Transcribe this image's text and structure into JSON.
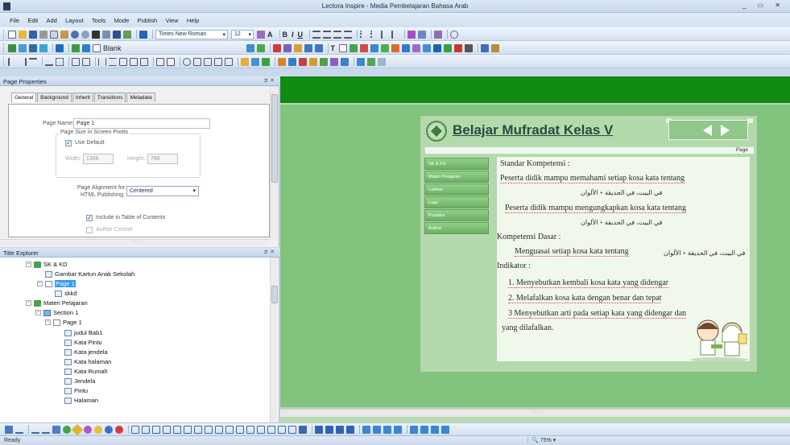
{
  "window": {
    "title": "Lectora Inspire - Media Pembelajaran Bahasa Arab",
    "controls": "_ ▭ ✕"
  },
  "menu": [
    "File",
    "Edit",
    "Add",
    "Layout",
    "Tools",
    "Mode",
    "Publish",
    "View",
    "Help"
  ],
  "toolbar": {
    "font_name": "Times New Roman",
    "font_size": "12",
    "style_label": "Blank"
  },
  "page_properties": {
    "panel_title": "Page Properties",
    "tabs": [
      "General",
      "Background",
      "Inherit",
      "Transitions",
      "Metadata"
    ],
    "page_name_label": "Page Name:",
    "page_name_value": "Page 1",
    "size_group_label": "Page Size in Screen Pixels",
    "use_default_label": "Use Default",
    "use_default_checked": true,
    "width_label": "Width:",
    "width_value": "1366",
    "height_label": "Height:",
    "height_value": "768",
    "alignment_label": "Page Alignment for HTML Publishing:",
    "alignment_value": "Centered",
    "include_toc_label": "Include in Table of Contents",
    "include_toc_checked": true,
    "author_control_label": "Author Control"
  },
  "title_explorer": {
    "panel_title": "Title Explorer",
    "items": [
      {
        "label": "SK & KD",
        "kind": "chapter",
        "expand": "−"
      },
      {
        "label": "Gambar Kartun Anak Sekolah",
        "kind": "object"
      },
      {
        "label": "Page 1",
        "kind": "page",
        "expand": "−",
        "selected": true
      },
      {
        "label": "skkd",
        "kind": "object"
      },
      {
        "label": "Materi Pelajaran",
        "kind": "chapter",
        "expand": "−"
      },
      {
        "label": "Section 1",
        "kind": "section",
        "expand": "−"
      },
      {
        "label": "Page 1",
        "kind": "page",
        "expand": "−"
      },
      {
        "label": "judul Bab1",
        "kind": "object"
      },
      {
        "label": "Kata Pintu",
        "kind": "object"
      },
      {
        "label": "Kata jendela",
        "kind": "object"
      },
      {
        "label": "Kata halaman",
        "kind": "object"
      },
      {
        "label": "Kata Rumah",
        "kind": "object"
      },
      {
        "label": "Jendela",
        "kind": "object"
      },
      {
        "label": "Pintu",
        "kind": "object"
      },
      {
        "label": "Halaman",
        "kind": "object"
      }
    ]
  },
  "stage": {
    "title": "Belajar Mufradat Kelas V",
    "page_bar": "Page",
    "side_menu": [
      "SK & KD",
      "Materi Pelajaran",
      "Latihan",
      "Lagu",
      "Pustaka",
      "Author"
    ],
    "content": {
      "sk_heading": "Standar Kompetensi :",
      "sk_line1": "Peserta didik mampu memahami setiap kosa kata tentang",
      "sk_arabic1": "في البيت، في الحديقة + الألوان",
      "sk_line2": "Peserta didik mampu mengungkapkan kosa kata tentang",
      "sk_arabic2": "في البيت، في الحديقة + الألوان",
      "kd_heading": "Kompetensi Dasar :",
      "kd_arabic": "في البيت، في الحديقة + الألوان",
      "kd_line": "Menguasai setiap kosa kata tentang",
      "ind_heading": "Indikator :",
      "ind_1": "1. Menyebutkan kembali kosa kata yang didengar",
      "ind_2": "2. Melafalkan kosa kata dengan benar dan tepat",
      "ind_3a": "3 Menyebutkan arti pada setiap kata yang didengar dan",
      "ind_3b": "yang dilafalkan."
    }
  },
  "status": {
    "text": "Ready",
    "zoom": "75%"
  },
  "colors": {
    "stage_green": "#108a10",
    "stage_light": "#82c47d",
    "title_text": "#2d4a3d",
    "menu_green": "#6bb062"
  }
}
